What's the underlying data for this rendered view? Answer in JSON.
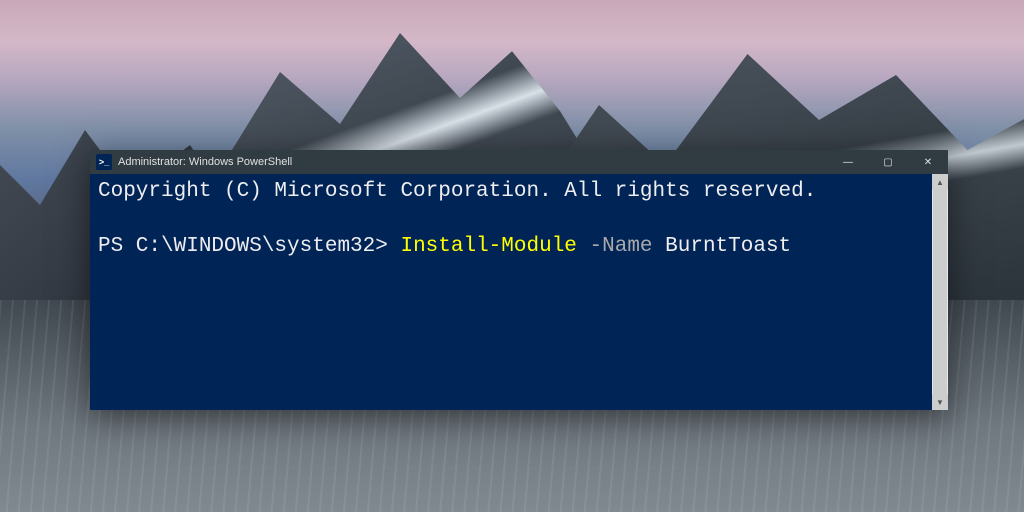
{
  "window": {
    "title": "Administrator: Windows PowerShell",
    "icon_glyph": ">_"
  },
  "console": {
    "copyright_line": "Copyright (C) Microsoft Corporation. All rights reserved.",
    "prompt": "PS C:\\WINDOWS\\system32>",
    "command": {
      "cmdlet": "Install-Module",
      "parameter": "-Name",
      "argument": "BurntToast"
    }
  },
  "controls": {
    "minimize": "—",
    "maximize": "▢",
    "close": "✕",
    "scroll_up": "▲",
    "scroll_down": "▼"
  },
  "colors": {
    "console_bg": "#012456",
    "console_fg": "#eeedf0",
    "cmdlet": "#ffff00",
    "param": "#a9a9a9",
    "titlebar": "#313c42"
  }
}
